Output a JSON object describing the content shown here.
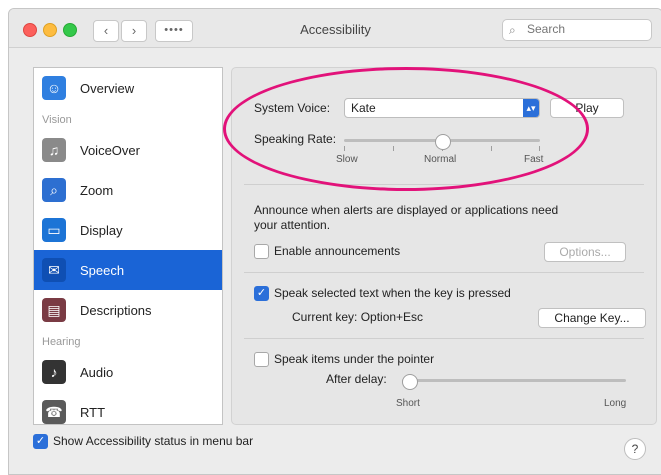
{
  "window": {
    "title": "Accessibility",
    "search_placeholder": "Search",
    "grid_label": "••••"
  },
  "sidebar": {
    "items": [
      {
        "label": "Overview",
        "icon": "overview-icon",
        "color": "#2f7fe0"
      },
      {
        "section": "Vision"
      },
      {
        "label": "VoiceOver",
        "icon": "voiceover-icon",
        "color": "#8a8a8a"
      },
      {
        "label": "Zoom",
        "icon": "zoom-icon",
        "color": "#2d6fd1"
      },
      {
        "label": "Display",
        "icon": "display-icon",
        "color": "#1c74d6"
      },
      {
        "label": "Speech",
        "icon": "speech-icon",
        "color": "#1a64d6",
        "selected": true
      },
      {
        "label": "Descriptions",
        "icon": "descriptions-icon",
        "color": "#7a3b44"
      },
      {
        "section": "Hearing"
      },
      {
        "label": "Audio",
        "icon": "audio-icon",
        "color": "#333333"
      },
      {
        "label": "RTT",
        "icon": "rtt-icon",
        "color": "#5a5a5a"
      }
    ]
  },
  "speech": {
    "system_voice_label": "System Voice:",
    "system_voice_value": "Kate",
    "play_label": "Play",
    "speaking_rate_label": "Speaking Rate:",
    "rate_slow": "Slow",
    "rate_normal": "Normal",
    "rate_fast": "Fast",
    "speaking_rate_level": 0.5,
    "announce_text_1": "Announce when alerts are displayed or applications need",
    "announce_text_2": "your attention.",
    "enable_announcements_label": "Enable announcements",
    "options_label": "Options...",
    "speak_selected_label": "Speak selected text when the key is pressed",
    "current_key_label": "Current key: Option+Esc",
    "change_key_label": "Change Key...",
    "speak_pointer_label": "Speak items under the pointer",
    "after_delay_label": "After delay:",
    "delay_short": "Short",
    "delay_long": "Long",
    "delay_level": 0.0
  },
  "footer": {
    "show_status_label": "Show Accessibility status in menu bar",
    "help_label": "?"
  },
  "colors": {
    "accent": "#2b6fd9",
    "highlight_ring": "#e2127a"
  }
}
